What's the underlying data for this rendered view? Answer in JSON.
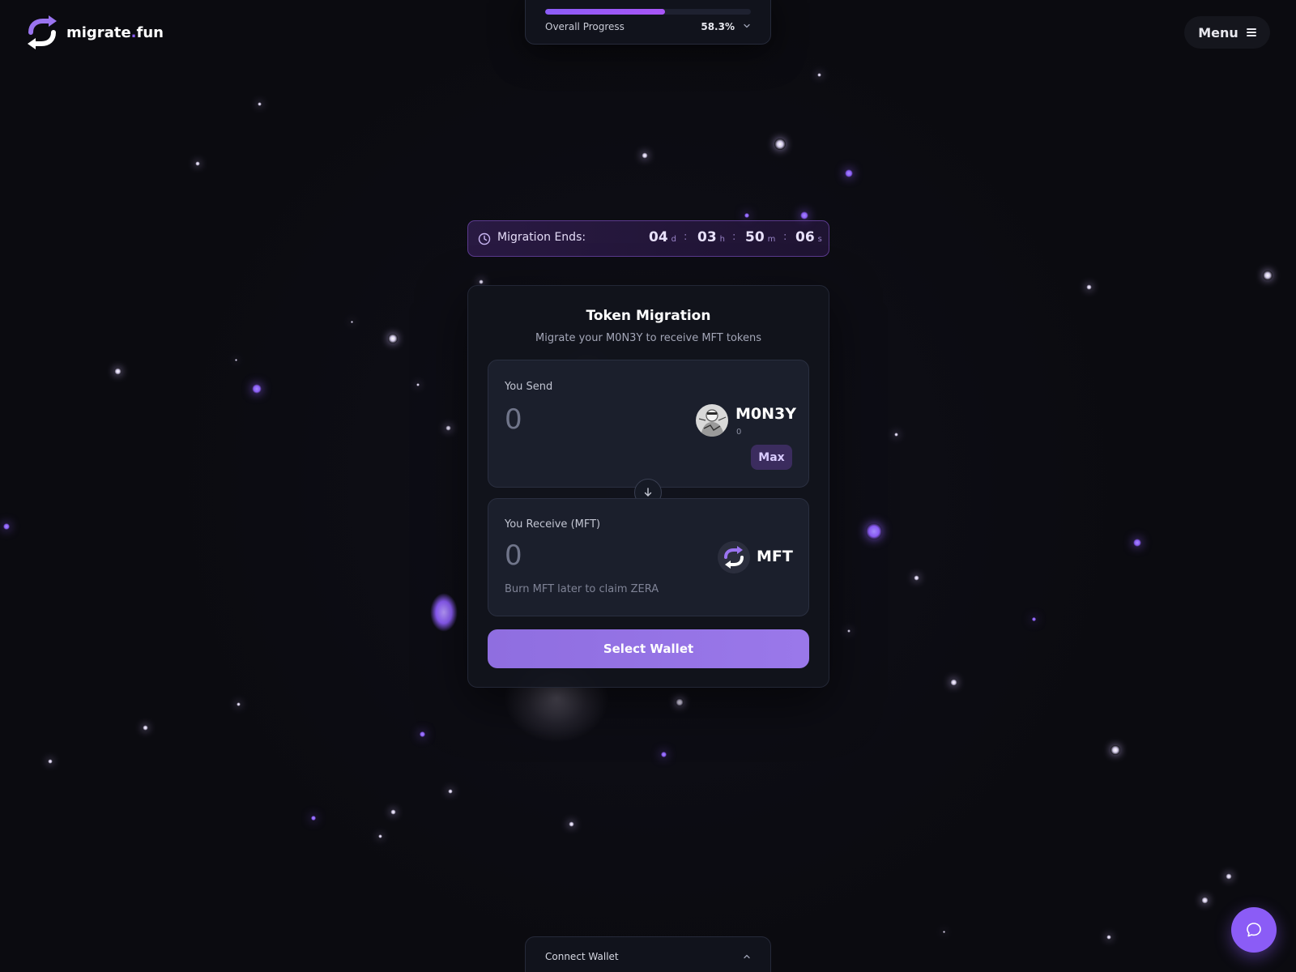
{
  "brand": {
    "name_main": "migrate",
    "name_dot": ".",
    "name_tld": "fun",
    "logo_icon": "sync-arrows-icon",
    "accent_color": "#8b5cf6"
  },
  "header": {
    "menu_label": "Menu",
    "menu_icon": "hamburger-icon"
  },
  "progress": {
    "label": "Overall Progress",
    "percent_text": "58.3%",
    "fraction": 0.583,
    "chevron_icon": "chevron-down-icon"
  },
  "countdown": {
    "label": "Migration Ends:",
    "clock_icon": "clock-icon",
    "days": "04",
    "days_unit": "d",
    "hours": "03",
    "hours_unit": "h",
    "minutes": "50",
    "minutes_unit": "m",
    "seconds": "06",
    "seconds_unit": "s",
    "separator": ":"
  },
  "card": {
    "title": "Token Migration",
    "subtitle": "Migrate your M0N3Y to receive MFT tokens",
    "send": {
      "label": "You Send",
      "amount_placeholder": "0",
      "token_name": "M0N3Y",
      "token_balance": "0",
      "max_label": "Max"
    },
    "swap_icon": "arrow-down-icon",
    "receive": {
      "label": "You Receive (MFT)",
      "amount_placeholder": "0",
      "token_name": "MFT",
      "note": "Burn MFT later to claim ZERA"
    },
    "submit_label": "Select Wallet"
  },
  "bottom_bar": {
    "label": "Connect Wallet",
    "chevron_icon": "chevron-up-icon"
  },
  "chat": {
    "icon": "chat-bubble-icon"
  }
}
